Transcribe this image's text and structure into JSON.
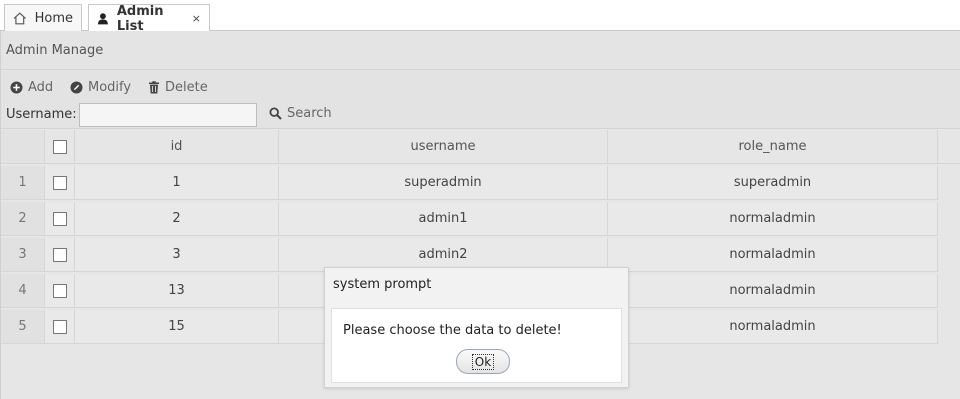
{
  "tabs": [
    {
      "label": "Home",
      "icon": "home-icon"
    },
    {
      "label": "Admin List",
      "icon": "user-icon",
      "close": "×"
    }
  ],
  "panel": {
    "title": "Admin Manage"
  },
  "toolbar": {
    "add_label": "Add",
    "modify_label": "Modify",
    "delete_label": "Delete"
  },
  "search": {
    "label": "Username:",
    "value": "",
    "button_label": "Search"
  },
  "grid": {
    "columns": [
      "id",
      "username",
      "role_name"
    ],
    "rows": [
      {
        "num": "1",
        "id": "1",
        "username": "superadmin",
        "role_name": "superadmin"
      },
      {
        "num": "2",
        "id": "2",
        "username": "admin1",
        "role_name": "normaladmin"
      },
      {
        "num": "3",
        "id": "3",
        "username": "admin2",
        "role_name": "normaladmin"
      },
      {
        "num": "4",
        "id": "13",
        "username": "",
        "role_name": "normaladmin"
      },
      {
        "num": "5",
        "id": "15",
        "username": "",
        "role_name": "normaladmin"
      }
    ]
  },
  "dialog": {
    "title": "system prompt",
    "message": "Please choose the data to delete!",
    "ok_label": "Ok"
  },
  "colors": {
    "panel_bg": "#e6e6e6",
    "toolbar_icon": "#555555",
    "dialog_button_border": "#9aa6b5"
  }
}
